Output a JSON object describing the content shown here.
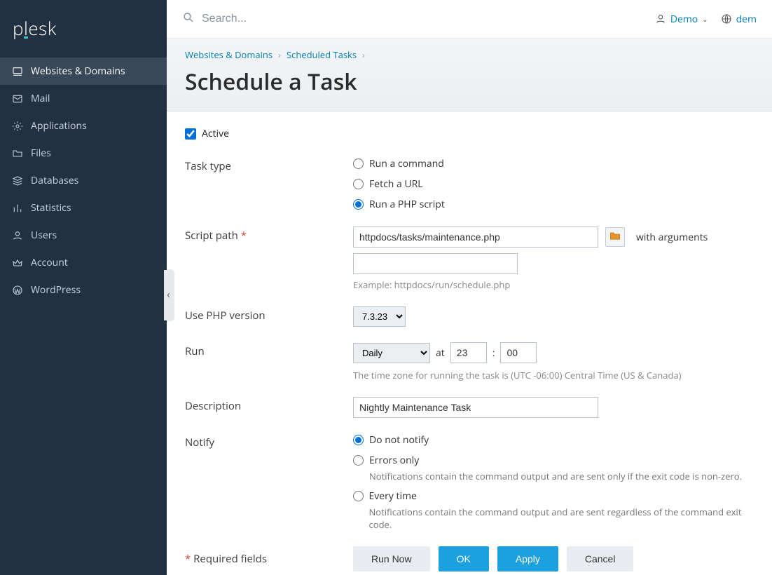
{
  "brand": "plesk",
  "search": {
    "placeholder": "Search..."
  },
  "topbar": {
    "user": "Demo",
    "lang": "dem"
  },
  "sidebar": {
    "items": [
      {
        "label": "Websites & Domains",
        "icon": "monitor-icon",
        "active": true
      },
      {
        "label": "Mail",
        "icon": "mail-icon"
      },
      {
        "label": "Applications",
        "icon": "gear-icon"
      },
      {
        "label": "Files",
        "icon": "folder-icon"
      },
      {
        "label": "Databases",
        "icon": "layers-icon"
      },
      {
        "label": "Statistics",
        "icon": "bars-icon"
      },
      {
        "label": "Users",
        "icon": "user-icon"
      },
      {
        "label": "Account",
        "icon": "crown-icon"
      },
      {
        "label": "WordPress",
        "icon": "wordpress-icon"
      }
    ]
  },
  "breadcrumb": {
    "items": [
      "Websites & Domains",
      "Scheduled Tasks"
    ]
  },
  "page_title": "Schedule a Task",
  "form": {
    "active_label": "Active",
    "active_checked": true,
    "task_type": {
      "label": "Task type",
      "options": [
        {
          "label": "Run a command",
          "selected": false
        },
        {
          "label": "Fetch a URL",
          "selected": false
        },
        {
          "label": "Run a PHP script",
          "selected": true
        }
      ]
    },
    "script_path": {
      "label": "Script path",
      "required": true,
      "value": "httpdocs/tasks/maintenance.php",
      "args_label": "with arguments",
      "args_value": "",
      "example": "Example: httpdocs/run/schedule.php"
    },
    "php_version": {
      "label": "Use PHP version",
      "value": "7.3.23",
      "options": [
        "7.3.23"
      ]
    },
    "run": {
      "label": "Run",
      "frequency": "Daily",
      "frequency_options": [
        "Daily"
      ],
      "at_label": "at",
      "hour": "23",
      "colon": ":",
      "minute": "00",
      "tz_note": "The time zone for running the task is (UTC -06:00) Central Time (US & Canada)"
    },
    "description": {
      "label": "Description",
      "value": "Nightly Maintenance Task"
    },
    "notify": {
      "label": "Notify",
      "options": [
        {
          "label": "Do not notify",
          "selected": true,
          "sub": ""
        },
        {
          "label": "Errors only",
          "selected": false,
          "sub": "Notifications contain the command output and are sent only if the exit code is non-zero."
        },
        {
          "label": "Every time",
          "selected": false,
          "sub": "Notifications contain the command output and are sent regardless of the command exit code."
        }
      ]
    },
    "required_note": "Required fields",
    "buttons": {
      "run_now": "Run Now",
      "ok": "OK",
      "apply": "Apply",
      "cancel": "Cancel"
    }
  }
}
